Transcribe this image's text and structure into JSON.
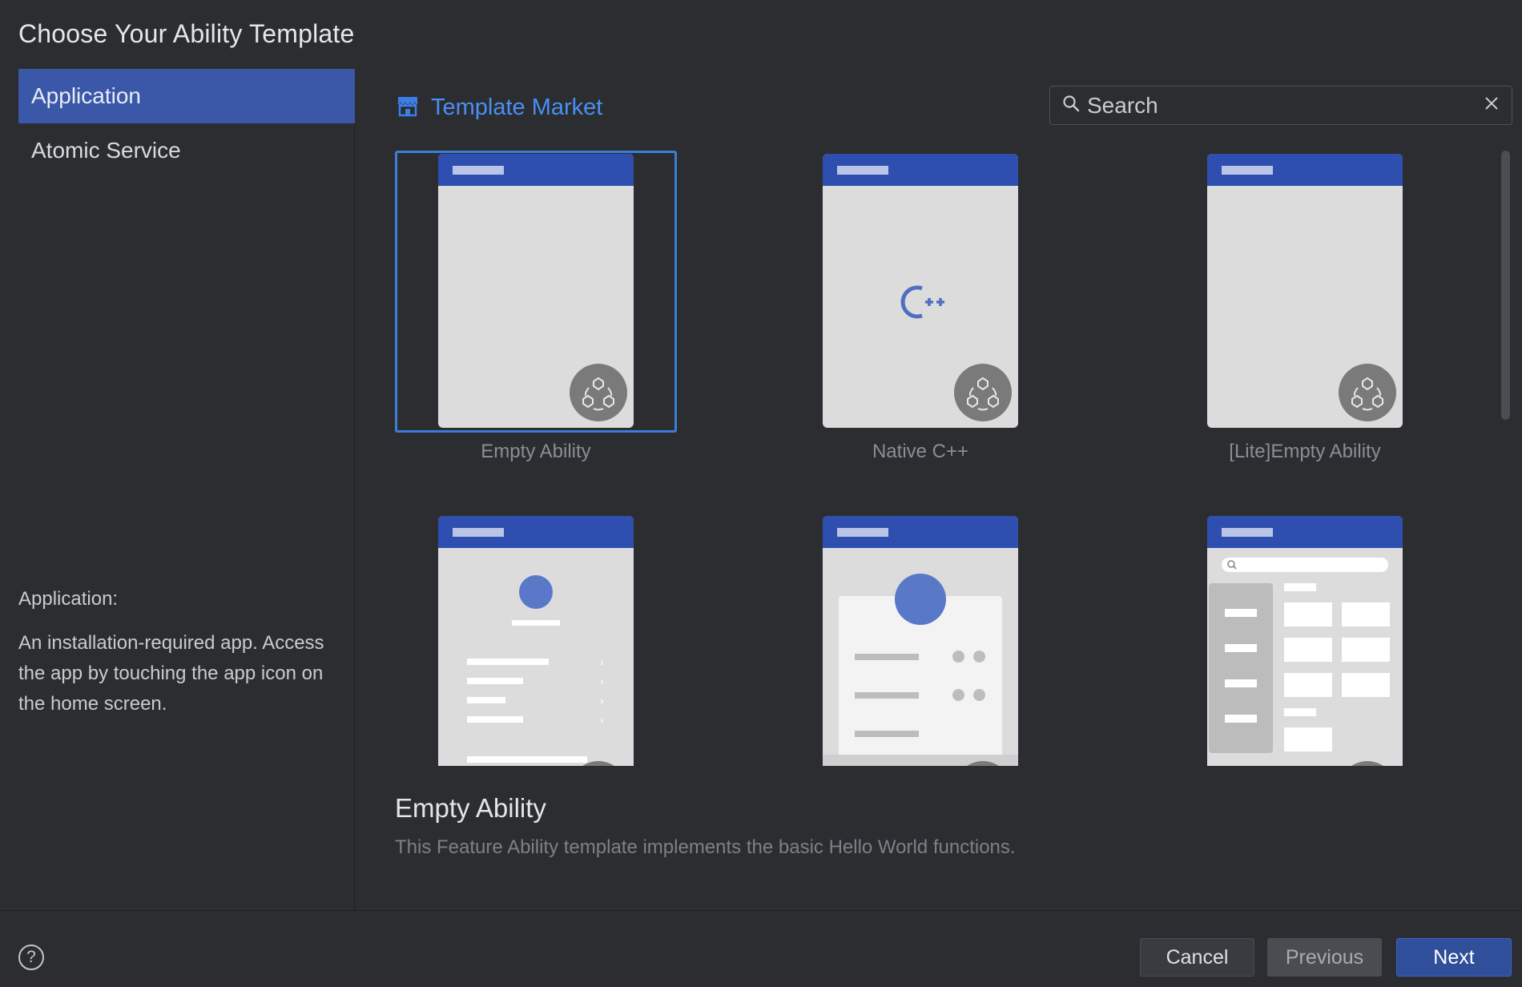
{
  "window": {
    "title": "Choose Your Ability Template"
  },
  "sidebar": {
    "items": [
      {
        "label": "Application",
        "selected": true
      },
      {
        "label": "Atomic Service",
        "selected": false
      }
    ],
    "description_title": "Application:",
    "description_text": "An installation-required app. Access the app by touching the app icon on the home screen."
  },
  "market": {
    "label": "Template Market"
  },
  "search": {
    "placeholder": "Search",
    "value": ""
  },
  "templates": [
    {
      "label": "Empty Ability",
      "selected": true
    },
    {
      "label": "Native C++",
      "selected": false
    },
    {
      "label": "[Lite]Empty Ability",
      "selected": false
    },
    {
      "label": "",
      "selected": false
    },
    {
      "label": "",
      "selected": false
    },
    {
      "label": "",
      "selected": false
    }
  ],
  "selected_template": {
    "title": "Empty Ability",
    "description": "This Feature Ability template implements the basic Hello World functions."
  },
  "footer": {
    "help_label": "?",
    "cancel_label": "Cancel",
    "previous_label": "Previous",
    "next_label": "Next"
  },
  "colors": {
    "accent": "#3b58a8",
    "link": "#4a8ff5",
    "phone_header": "#2f4fb0",
    "background": "#2b2d30"
  }
}
